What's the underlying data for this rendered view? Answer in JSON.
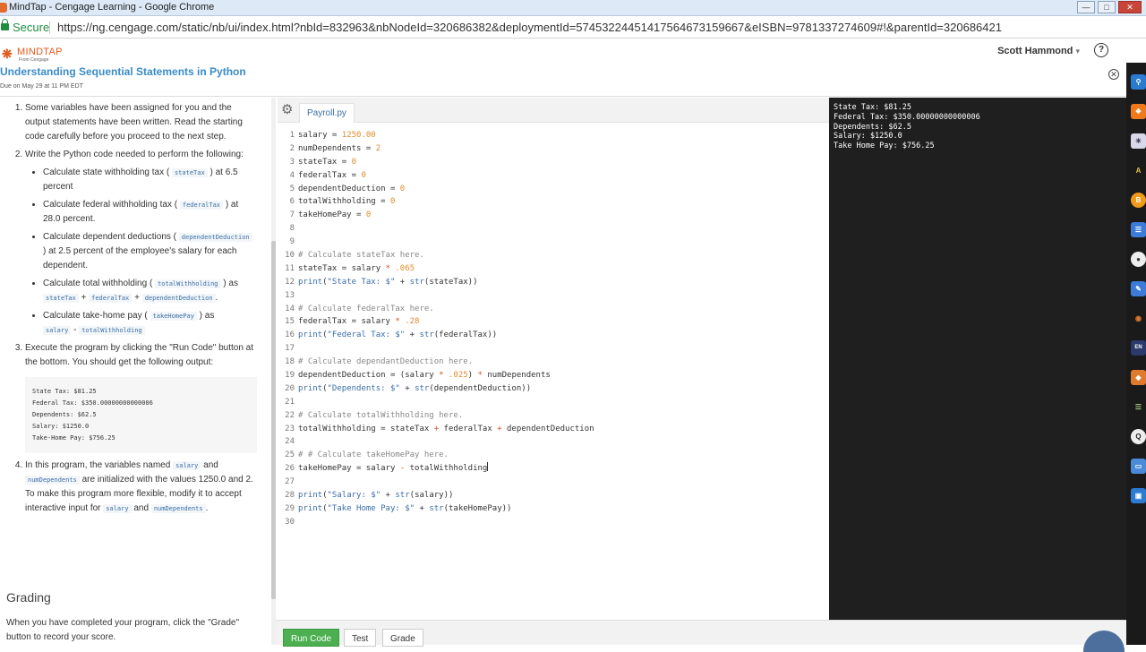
{
  "window": {
    "title": "MindTap - Cengage Learning - Google Chrome"
  },
  "addressbar": {
    "secure_label": "Secure",
    "url": "https://ng.cengage.com/static/nb/ui/index.html?nbId=832963&nbNodeId=320686382&deploymentId=57453224451417564673159667&eISBN=9781337274609#!&parentId=320686421"
  },
  "header": {
    "logo_name": "MINDTAP",
    "logo_sub": "From Cengage",
    "user_name": "Scott Hammond",
    "help_label": "?",
    "activity_title": "Understanding Sequential Statements in Python",
    "due": "Due on May 29 at 11 PM EDT"
  },
  "instructions": {
    "step1": "Some variables have been assigned for you and the output statements have been written. Read the starting code carefully before you proceed to the next step.",
    "step2_intro": "Write the Python code needed to perform the following:",
    "b1_pre": "Calculate state withholding tax (",
    "b1_code": "stateTax",
    "b1_post": ") at 6.5 percent",
    "b2_pre": "Calculate federal withholding tax (",
    "b2_code": "federalTax",
    "b2_post": ") at 28.0 percent.",
    "b3_pre": "Calculate dependent deductions (",
    "b3_code": "dependentDeduction",
    "b3_post": ") at 2.5 percent of the employee's salary for each dependent.",
    "b4_pre": "Calculate total withholding (",
    "b4_code": "totalWithholding",
    "b4_post": ") as",
    "b4_c1": "stateTax",
    "b4_plus1": "+",
    "b4_c2": "federalTax",
    "b4_plus2": "+",
    "b4_c3": "dependentDeduction",
    "b4_end": ".",
    "b5_pre": "Calculate take-home pay (",
    "b5_code": "takeHomePay",
    "b5_post": ") as",
    "b5_c1": "salary",
    "b5_minus": "-",
    "b5_c2": "totalWithholding",
    "step3": "Execute the program by clicking the \"Run Code\" button at the bottom. You should get the following output:",
    "expected_output": "State Tax: $81.25\nFederal Tax: $350.00000000000006\nDependents: $62.5\nSalary: $1250.0\nTake-Home Pay: $756.25",
    "step4_a": "In this program, the variables named",
    "step4_c1": "salary",
    "step4_b": "and",
    "step4_c2": "numDependents",
    "step4_c": "are initialized with the values 1250.0 and 2. To make this program more flexible, modify it to accept interactive input for",
    "step4_c3": "salary",
    "step4_d": "and",
    "step4_c4": "numDependents",
    "step4_e": ".",
    "grading_heading": "Grading",
    "grading_text": "When you have completed your program, click the \"Grade\" button to record your score."
  },
  "editor": {
    "tab_label": "Payroll.py",
    "lines": [
      "1",
      "2",
      "3",
      "4",
      "5",
      "6",
      "7",
      "8",
      "9",
      "10",
      "11",
      "12",
      "13",
      "14",
      "15",
      "16",
      "17",
      "18",
      "19",
      "20",
      "21",
      "22",
      "23",
      "24",
      "25",
      "26",
      "27",
      "28",
      "29",
      "30"
    ],
    "code": {
      "l1": [
        "salary = ",
        "1250.00"
      ],
      "l2": [
        "numDependents = ",
        "2"
      ],
      "l3": [
        "stateTax = ",
        "0"
      ],
      "l4": [
        "federalTax = ",
        "0"
      ],
      "l5": [
        "dependentDeduction = ",
        "0"
      ],
      "l6": [
        "totalWithholding = ",
        "0"
      ],
      "l7": [
        "takeHomePay = ",
        "0"
      ],
      "l10": "# Calculate stateTax here.",
      "l11": [
        "stateTax = salary ",
        "*",
        " ",
        ".065"
      ],
      "l12": [
        "print",
        "(",
        "\"State Tax: $\"",
        " + ",
        "str",
        "(stateTax))"
      ],
      "l14": "# Calculate federalTax here.",
      "l15": [
        "federalTax = salary ",
        "*",
        " ",
        ".28"
      ],
      "l16": [
        "print",
        "(",
        "\"Federal Tax: $\"",
        " + ",
        "str",
        "(federalTax))"
      ],
      "l18": "# Calculate dependantDeduction here.",
      "l19": [
        "dependentDeduction = (salary ",
        "*",
        " ",
        ".025",
        ") ",
        "*",
        " numDependents"
      ],
      "l20": [
        "print",
        "(",
        "\"Dependents: $\"",
        " + ",
        "str",
        "(dependentDeduction))"
      ],
      "l22": "# Calculate totalWithholding here.",
      "l23": [
        "totalWithholding = stateTax ",
        "+",
        " federalTax ",
        "+",
        " dependentDeduction"
      ],
      "l25": "# # Calculate takeHomePay here.",
      "l26": [
        "takeHomePay = salary ",
        "-",
        " totalWithholding"
      ],
      "l28": [
        "print",
        "(",
        "\"Salary: $\"",
        " + ",
        "str",
        "(salary))"
      ],
      "l29": [
        "print",
        "(",
        "\"Take Home Pay: $\"",
        " + ",
        "str",
        "(takeHomePay))"
      ]
    }
  },
  "console": {
    "output": "State Tax: $81.25\nFederal Tax: $350.00000000000006\nDependents: $62.5\nSalary: $1250.0\nTake Home Pay: $756.25"
  },
  "toolbar": {
    "run_label": "Run Code",
    "test_label": "Test",
    "grade_label": "Grade"
  },
  "extensions": [
    "search-icon",
    "rss-icon",
    "weather-icon",
    "a-z-icon",
    "bitcoin-icon",
    "docs-icon",
    "profile-icon",
    "pencil-icon",
    "signal-icon",
    "endnote-icon",
    "shield-icon",
    "list-icon",
    "q-icon",
    "screen-icon",
    "box-icon"
  ],
  "colors": {
    "accent_blue": "#3a8cc9",
    "run_green": "#4caf50",
    "mindtap_orange": "#e35a1c",
    "console_bg": "#1f1f1f"
  }
}
